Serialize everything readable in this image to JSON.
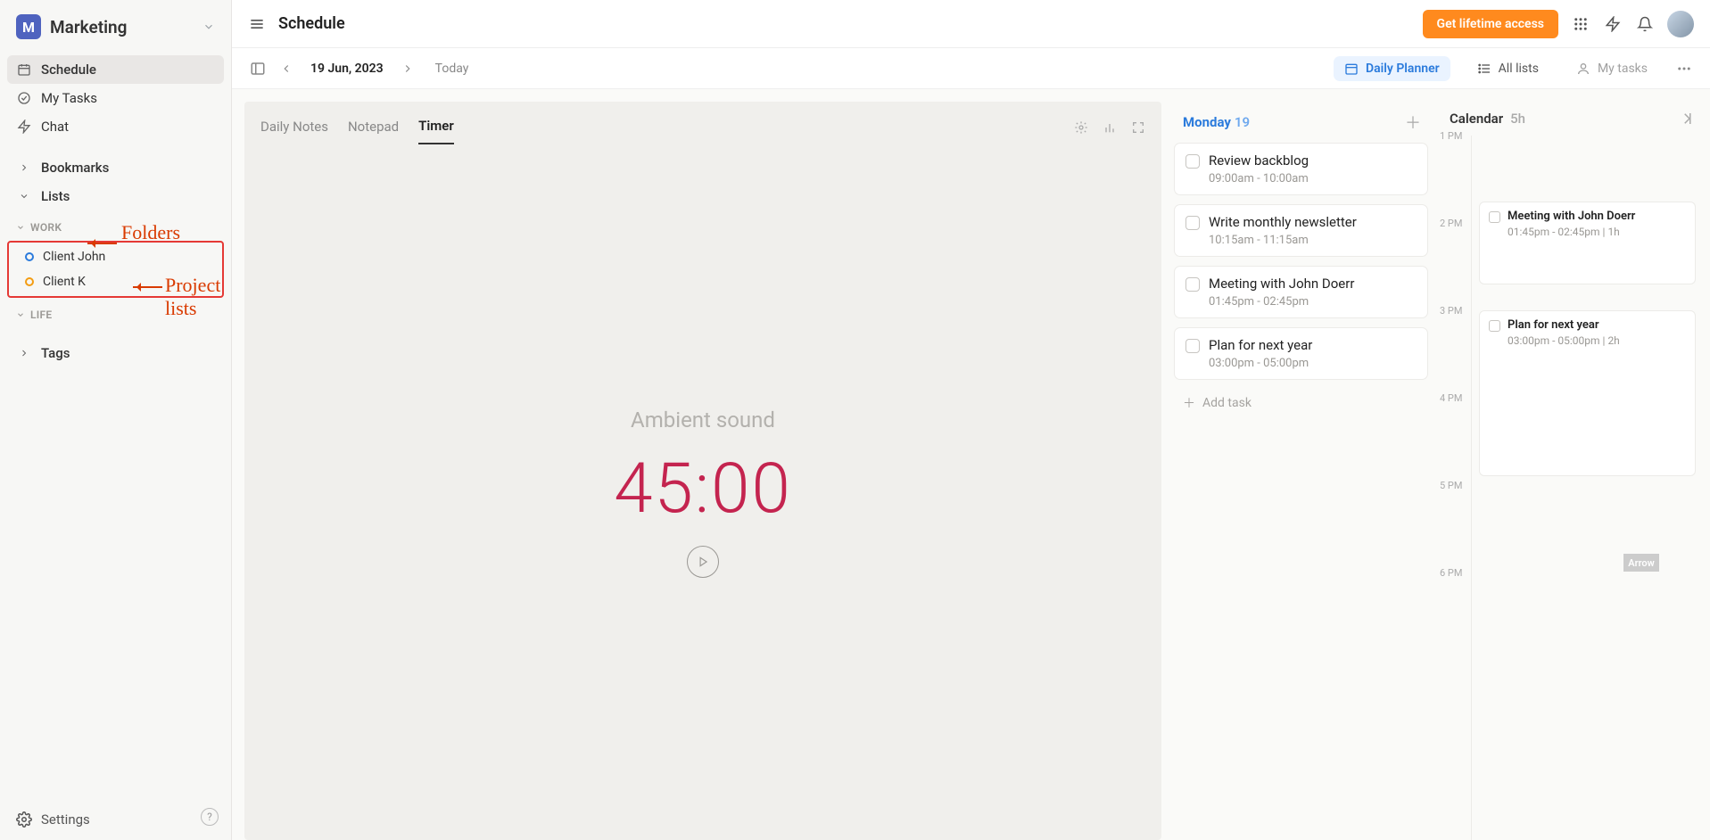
{
  "workspace": {
    "initial": "M",
    "name": "Marketing"
  },
  "sidebar": {
    "schedule": "Schedule",
    "mytasks": "My Tasks",
    "chat": "Chat",
    "bookmarks": "Bookmarks",
    "lists": "Lists",
    "work": "WORK",
    "life": "LIFE",
    "tags": "Tags",
    "clients": [
      {
        "label": "Client John"
      },
      {
        "label": "Client K"
      }
    ],
    "settings": "Settings"
  },
  "annotations": {
    "folders": "Folders",
    "project_lists": "Project lists",
    "arrow_lit": "Arrow"
  },
  "topbar": {
    "title": "Schedule",
    "cta": "Get lifetime access"
  },
  "toolbar": {
    "date": "19 Jun, 2023",
    "today": "Today",
    "daily_planner": "Daily Planner",
    "all_lists": "All lists",
    "my_tasks": "My tasks"
  },
  "notes": {
    "tab_daily": "Daily Notes",
    "tab_notepad": "Notepad",
    "tab_timer": "Timer",
    "ambient": "Ambient sound",
    "timer": "45:00"
  },
  "day_col": {
    "weekday": "Monday",
    "daynum": "19",
    "tasks": [
      {
        "title": "Review backblog",
        "time": "09:00am - 10:00am"
      },
      {
        "title": "Write monthly newsletter",
        "time": "10:15am - 11:15am"
      },
      {
        "title": "Meeting with John Doerr",
        "time": "01:45pm - 02:45pm"
      },
      {
        "title": "Plan for next year",
        "time": "03:00pm - 05:00pm"
      }
    ],
    "add": "Add task"
  },
  "calendar": {
    "title": "Calendar",
    "duration": "5h",
    "hours": [
      "1 PM",
      "2 PM",
      "3 PM",
      "4 PM",
      "5 PM",
      "6 PM"
    ],
    "events": [
      {
        "title": "Meeting with John Doerr",
        "meta": "01:45pm - 02:45pm | 1h"
      },
      {
        "title": "Plan for next year",
        "meta": "03:00pm - 05:00pm | 2h"
      }
    ]
  }
}
